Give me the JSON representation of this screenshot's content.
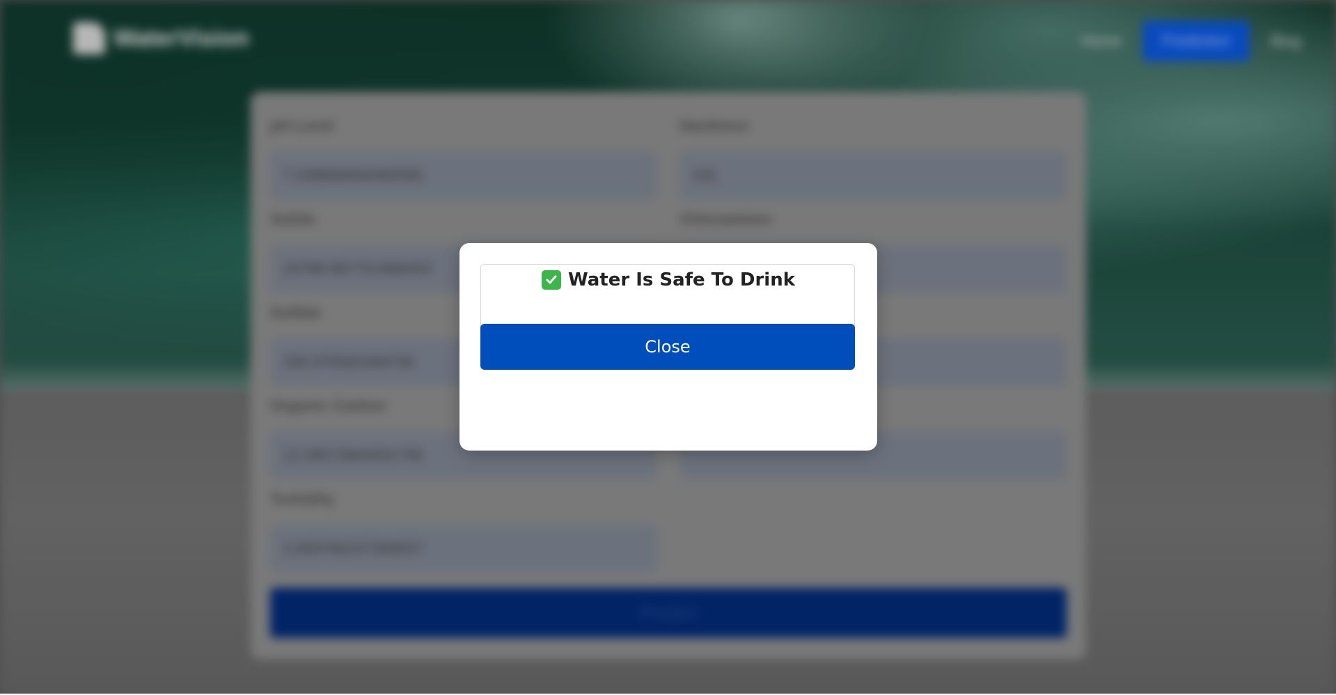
{
  "navbar": {
    "logo_text": "WaterVision",
    "links": [
      "Home",
      "Prediction",
      "Blog"
    ]
  },
  "form": {
    "fields": [
      {
        "label": "pH Level",
        "value": "7.038866656460595"
      },
      {
        "label": "Hardness",
        "value": "191"
      },
      {
        "label": "Solids",
        "value": "20788.987751968453"
      },
      {
        "label": "Chloramines",
        "value": ""
      },
      {
        "label": "Sulfate",
        "value": "335.976582369756"
      },
      {
        "label": "",
        "value": ""
      },
      {
        "label": "Organic Carbon",
        "value": "13.39573664051756"
      },
      {
        "label": "",
        "value": ""
      },
      {
        "label": "Turbidity",
        "value": "3.959766237369557"
      }
    ],
    "submit_label": "Predict"
  },
  "modal": {
    "title": "Water Is Safe To Drink",
    "close_label": "Close",
    "icon": "check-mark-icon"
  },
  "colors": {
    "modal_button": "#004ebc",
    "check_icon": "#3cb54a",
    "nav_button": "#0a55d8"
  }
}
